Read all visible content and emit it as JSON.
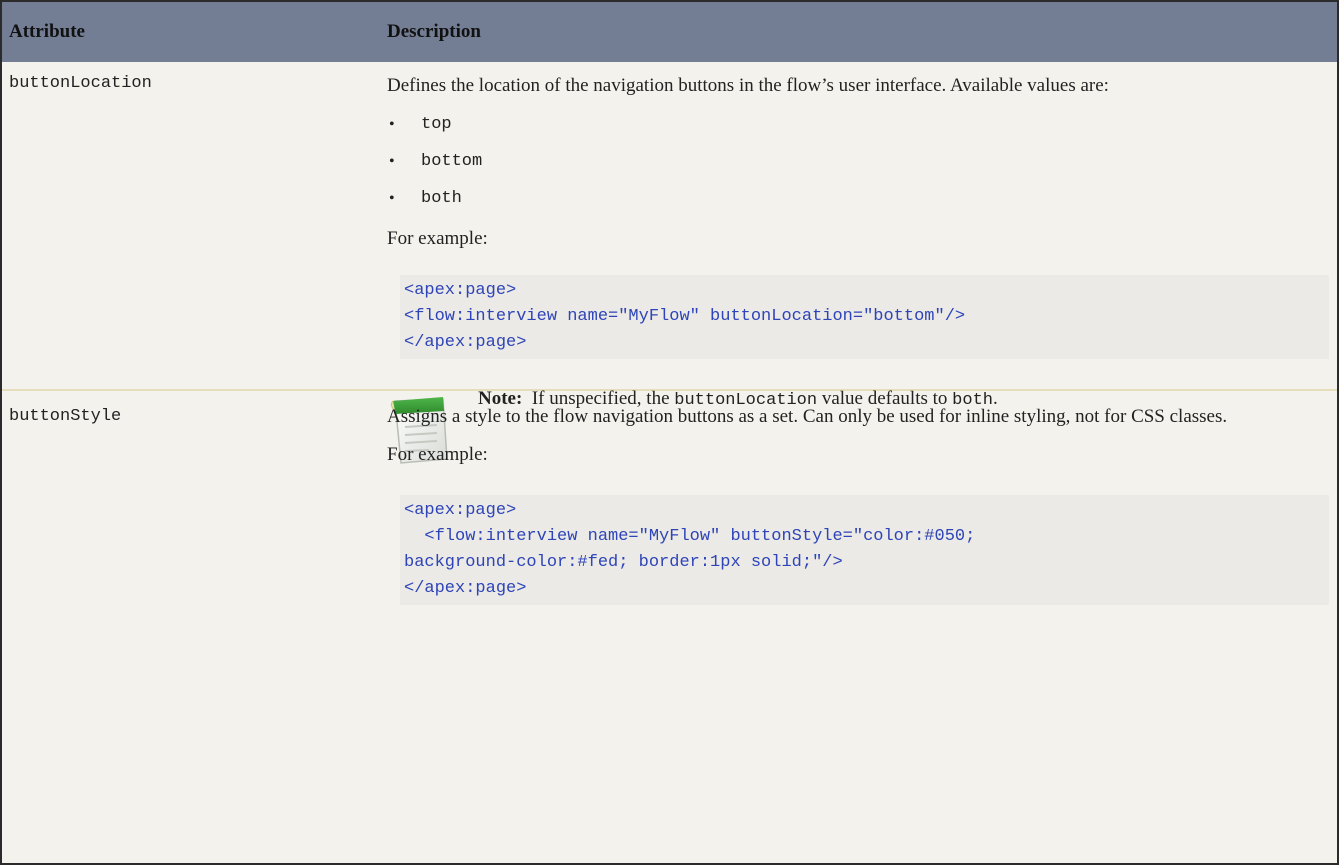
{
  "table": {
    "headers": {
      "attribute": "Attribute",
      "description": "Description"
    },
    "rows": [
      {
        "attribute": "buttonLocation",
        "description": "Defines the location of the navigation buttons in the flow’s user interface. Available values are:",
        "values": [
          "top",
          "bottom",
          "both"
        ],
        "example_label": "For example:",
        "code_lines": [
          "<apex:page>",
          "<flow:interview name=\"MyFlow\" buttonLocation=\"bottom\"/>",
          "</apex:page>"
        ],
        "note": {
          "label": "Note:",
          "text_before": "If unspecified, the",
          "code": "buttonLocation",
          "text_middle": "value defaults to",
          "default_value": "both",
          "text_after": "."
        }
      },
      {
        "attribute": "buttonStyle",
        "description": "Assigns a style to the flow navigation buttons as a set. Can only be used for inline styling, not for CSS classes.",
        "example_label": "For example:",
        "code_lines": [
          "<apex:page>",
          "  <flow:interview name=\"MyFlow\" buttonStyle=\"color:#050;",
          "background-color:#fed; border:1px solid;\"/>",
          "</apex:page>"
        ]
      }
    ]
  },
  "colors": {
    "header_bg": "#737e95",
    "table_bg": "#f3f2ec",
    "code_bg": "#ebeae6",
    "code_text": "#2e44b8",
    "row_divider": "#e6ddbd"
  },
  "icons": {
    "note": "notepad-icon"
  }
}
